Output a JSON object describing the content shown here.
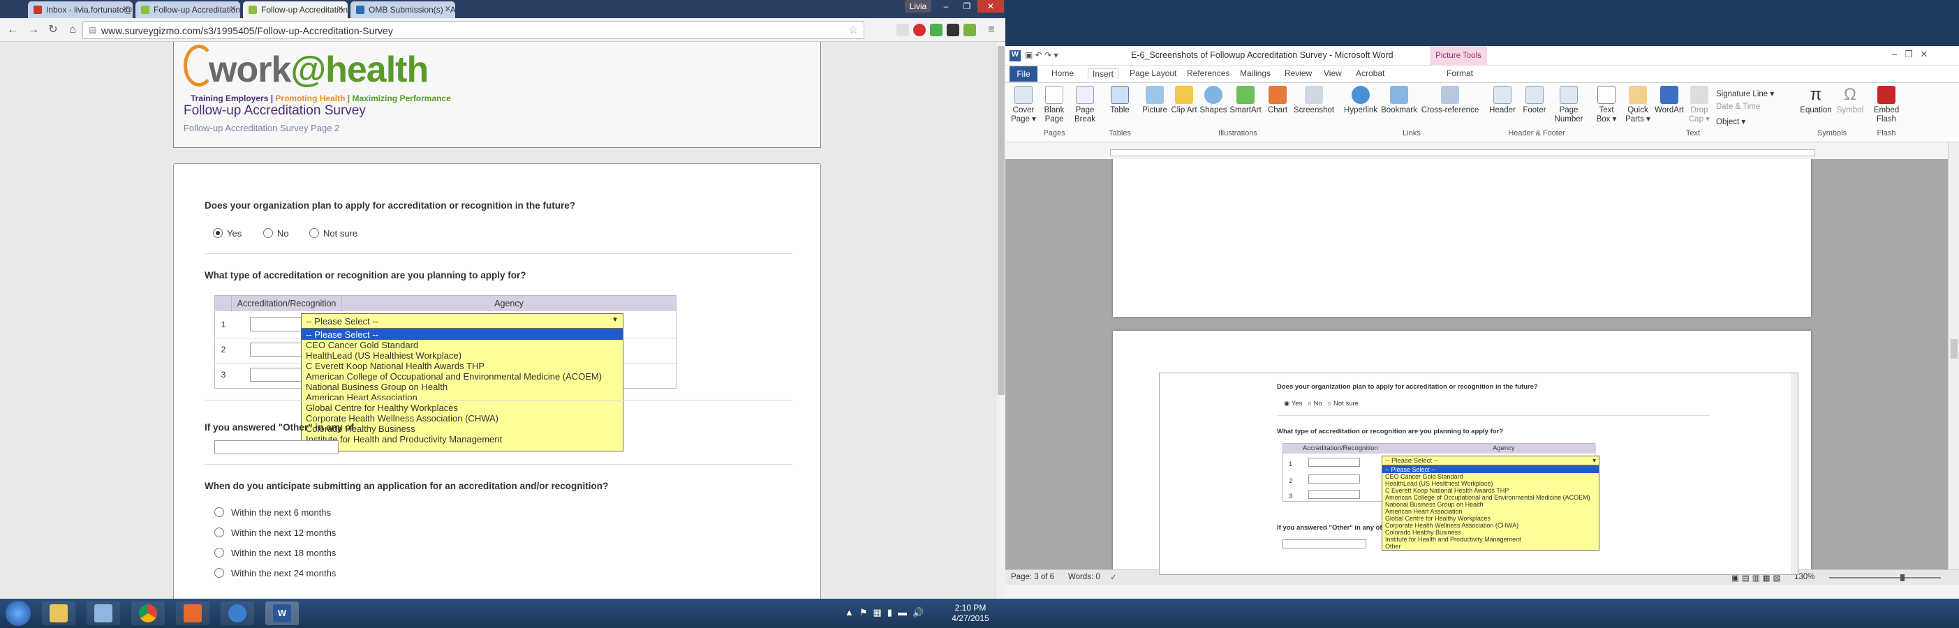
{
  "chrome": {
    "tabs": [
      {
        "label": "Inbox - livia.fortunato@g",
        "color": "#c0392b"
      },
      {
        "label": "Follow-up Accreditation S",
        "color": "#8bbf3f"
      },
      {
        "label": "Follow-up Accreditation S",
        "color": "#8bbf3f"
      },
      {
        "label": "OMB Submission(s) - All D",
        "color": "#2c6bb3"
      }
    ],
    "user_badge": "Livia",
    "url": "www.surveygizmo.com/s3/1995405/Follow-up-Accreditation-Survey",
    "icons": [
      "back-icon",
      "forward-icon",
      "reload-icon",
      "home-icon",
      "star-icon",
      "menu-icon"
    ]
  },
  "survey": {
    "logo_word": "work",
    "logo_at": "@",
    "logo_health": "health",
    "tag_1": "Training Employers |",
    "tag_2": "Promoting Health",
    "tag_3": "| Maximizing Performance",
    "title": "Follow-up Accreditation Survey",
    "subtitle": "Follow-up Accreditation Survey Page 2",
    "q1": {
      "text": "Does your organization plan to apply for accreditation or recognition in the future?",
      "options": [
        "Yes",
        "No",
        "Not sure"
      ],
      "selected": "Yes"
    },
    "q2": {
      "text": "What type of accreditation or recognition are you planning to apply for?",
      "col_1": "Accreditation/Recognition",
      "col_2": "Agency",
      "rows": [
        "1",
        "2",
        "3"
      ],
      "select_value": "-- Please Select --",
      "dropdown_options": [
        "-- Please Select --",
        "CEO Cancer Gold Standard",
        "HealthLead (US Healthiest Workplace)",
        "C Everett Koop National Health Awards THP",
        "American College of Occupational and Environmental Medicine (ACOEM)",
        "National Business Group on Health",
        "American Heart Association",
        "Global Centre for Healthy Workplaces",
        "Corporate Health Wellness Association (CHWA)",
        "Colorado Healthy Business",
        "Institute for Health and Productivity Management",
        "Other"
      ]
    },
    "q3": {
      "text": "If you answered \"Other\" in any of"
    },
    "q4": {
      "text": "When do you anticipate submitting an application for an accreditation and/or recognition?",
      "options": [
        "Within the next 6 months",
        "Within the next 12 months",
        "Within the next 18 months",
        "Within the next 24 months"
      ]
    }
  },
  "word": {
    "title": "E-6_Screenshots of Followup Accreditation Survey  -  Microsoft Word",
    "context_tab": "Picture Tools",
    "tabs": [
      "File",
      "Home",
      "Insert",
      "Page Layout",
      "References",
      "Mailings",
      "Review",
      "View",
      "Acrobat",
      "Format"
    ],
    "ribbon_buttons": [
      {
        "label": "Cover Page ▾",
        "group": "pages"
      },
      {
        "label": "Blank Page",
        "group": "pages"
      },
      {
        "label": "Page Break",
        "group": "pages"
      },
      {
        "label": "Table",
        "group": "tables"
      },
      {
        "label": "Picture",
        "group": "illus"
      },
      {
        "label": "Clip Art",
        "group": "illus"
      },
      {
        "label": "Shapes",
        "group": "illus"
      },
      {
        "label": "SmartArt",
        "group": "illus"
      },
      {
        "label": "Chart",
        "group": "illus"
      },
      {
        "label": "Screenshot",
        "group": "illus"
      },
      {
        "label": "Hyperlink",
        "group": "links"
      },
      {
        "label": "Bookmark",
        "group": "links"
      },
      {
        "label": "Cross-reference",
        "group": "links"
      },
      {
        "label": "Header",
        "group": "hf"
      },
      {
        "label": "Footer",
        "group": "hf"
      },
      {
        "label": "Page Number",
        "group": "hf"
      },
      {
        "label": "Text Box ▾",
        "group": "text"
      },
      {
        "label": "Quick Parts ▾",
        "group": "text"
      },
      {
        "label": "WordArt",
        "group": "text"
      },
      {
        "label": "Drop Cap ▾",
        "group": "text"
      },
      {
        "label": "Equation",
        "group": "symbols"
      },
      {
        "label": "Symbol",
        "group": "symbols"
      },
      {
        "label": "Embed Flash",
        "group": "flash"
      }
    ],
    "groups": [
      "Pages",
      "Tables",
      "Illustrations",
      "Links",
      "Header & Footer",
      "Text",
      "Symbols",
      "Flash"
    ],
    "text_small": [
      "Signature Line ▾",
      "Date & Time",
      "Object ▾"
    ],
    "status_page": "Page: 3 of 6",
    "status_words": "Words: 0",
    "zoom": "130%",
    "mini_q1": "Does your organization plan to apply for accreditation or recognition in the future?",
    "mini_q2": "What type of accreditation or recognition are you planning to apply for?",
    "mini_q3": "If you answered \"Other\" in any of"
  },
  "taskbar": {
    "time": "2:10 PM",
    "date": "4/27/2015"
  },
  "colors": {
    "accent_purple": "#4b2e6f",
    "select_yellow": "#ffff99",
    "highlight_blue": "#1e5bd1",
    "brand_green": "#5a9a2c",
    "brand_orange": "#e8902a"
  }
}
